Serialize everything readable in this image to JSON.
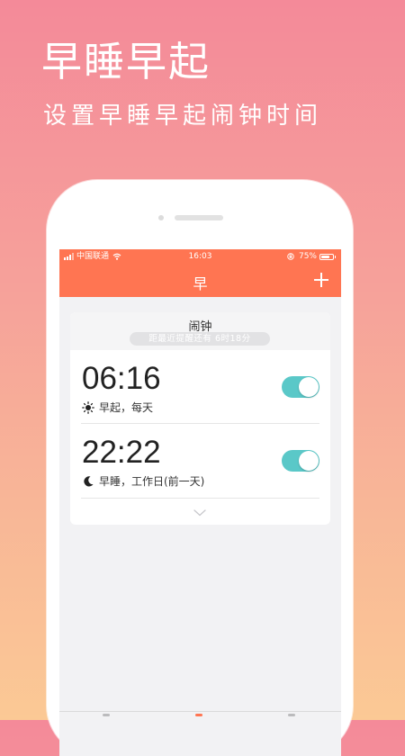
{
  "promo": {
    "title": "早睡早起",
    "subtitle": "设置早睡早起闹钟时间"
  },
  "status_bar": {
    "carrier": "中国联通",
    "time": "16:03",
    "battery": "75%",
    "battery_level": 0.75
  },
  "nav": {
    "title": "早",
    "add_icon": "plus-icon"
  },
  "card": {
    "title": "闹钟",
    "subtitle": "距最近提醒还有 6时18分"
  },
  "alarms": [
    {
      "time": "06:16",
      "icon": "sun-icon",
      "label": "早起，每天",
      "enabled": true
    },
    {
      "time": "22:22",
      "icon": "moon-icon",
      "label": "早睡，工作日(前一天)",
      "enabled": true
    }
  ],
  "colors": {
    "accent": "#ff7552",
    "toggle_on": "#5ac8c8",
    "background_top": "#f48a99",
    "background_bottom": "#fbc995"
  }
}
